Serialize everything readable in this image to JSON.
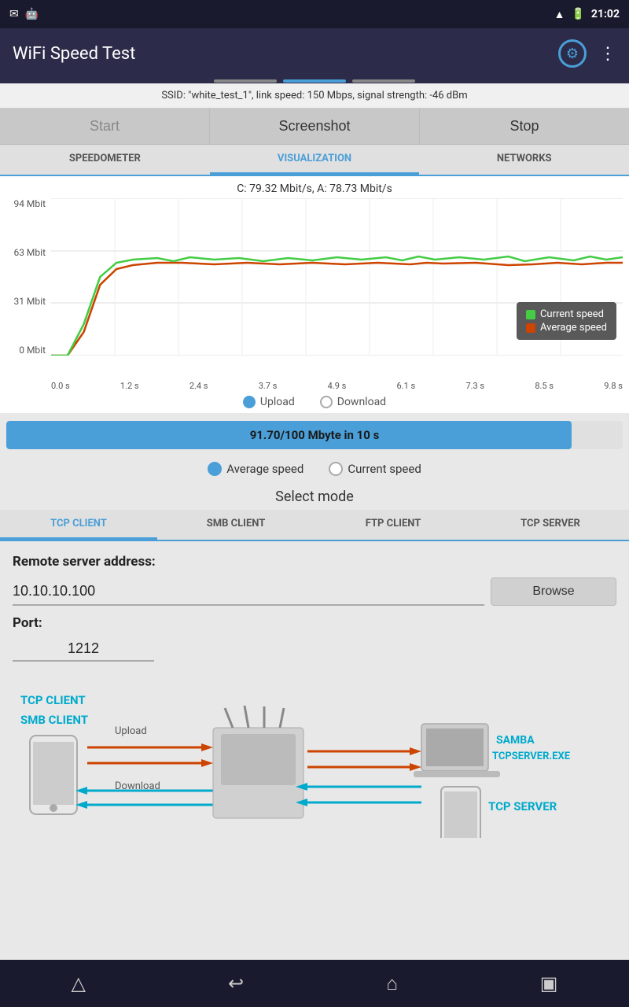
{
  "status_bar": {
    "time": "21:02",
    "icons_left": [
      "msg-icon",
      "android-icon"
    ],
    "icons_right": [
      "wifi-icon",
      "battery-icon"
    ]
  },
  "app_bar": {
    "title": "WiFi Speed Test"
  },
  "ssid_info": {
    "text": "SSID: \"white_test_1\", link speed: 150 Mbps, signal strength: -46 dBm"
  },
  "action_buttons": {
    "start": "Start",
    "screenshot": "Screenshot",
    "stop": "Stop"
  },
  "vis_tabs": [
    {
      "label": "SPEEDOMETER",
      "active": false
    },
    {
      "label": "VISUALIZATION",
      "active": true
    },
    {
      "label": "NETWORKS",
      "active": false
    }
  ],
  "chart": {
    "title": "C: 79.32 Mbit/s, A: 78.73 Mbit/s",
    "y_labels": [
      "94 Mbit",
      "63 Mbit",
      "31 Mbit",
      "0 Mbit"
    ],
    "x_labels": [
      "0.0 s",
      "1.2 s",
      "2.4 s",
      "3.7 s",
      "4.9 s",
      "6.1 s",
      "7.3 s",
      "8.5 s",
      "9.8 s"
    ],
    "legend": {
      "current_speed": "Current speed",
      "average_speed": "Average speed"
    }
  },
  "upload_download": {
    "upload_label": "Upload",
    "download_label": "Download",
    "selected": "upload"
  },
  "progress": {
    "text": "91.70/100 Mbyte in 10 s",
    "percent": 91.7
  },
  "speed_radio": {
    "average": "Average speed",
    "current": "Current speed",
    "selected": "average"
  },
  "select_mode": {
    "label": "Select mode"
  },
  "mode_tabs": [
    {
      "label": "TCP CLIENT",
      "active": true
    },
    {
      "label": "SMB CLIENT",
      "active": false
    },
    {
      "label": "FTP CLIENT",
      "active": false
    },
    {
      "label": "TCP SERVER",
      "active": false
    }
  ],
  "remote_server": {
    "label": "Remote server address:",
    "value": "10.10.10.100",
    "browse_label": "Browse"
  },
  "port": {
    "label": "Port:",
    "value": "1212"
  },
  "diagram": {
    "tcp_client_label": "TCP CLIENT",
    "smb_client_label": "SMB CLIENT",
    "upload_label": "Upload",
    "download_label": "Download",
    "samba_label": "SAMBA",
    "tcpserver_label": "TCPSERVER.EXE",
    "tcp_server_label": "TCP SERVER"
  },
  "bottom_nav": {
    "back_icon": "⬅",
    "home_icon": "⌂",
    "recents_icon": "▣",
    "menu_icon": "△"
  }
}
